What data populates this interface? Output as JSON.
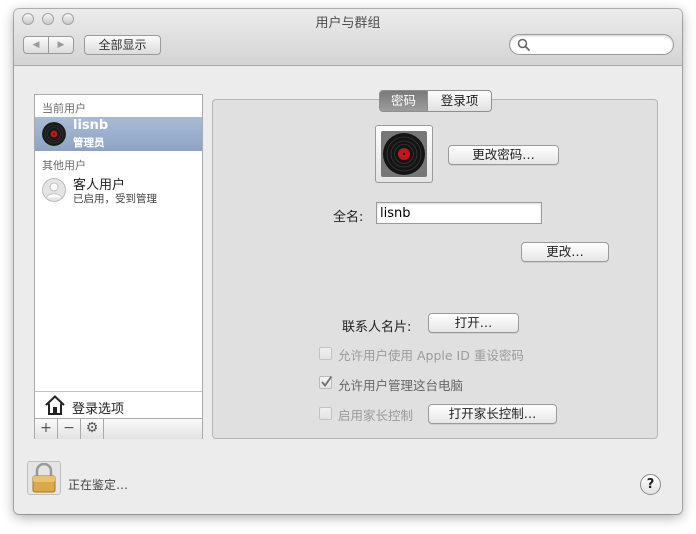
{
  "window": {
    "title": "用户与群组",
    "show_all_label": "全部显示",
    "search_placeholder": ""
  },
  "sidebar": {
    "current_users_header": "当前用户",
    "other_users_header": "其他用户",
    "current_user": {
      "name": "lisnb",
      "role": "管理员"
    },
    "guest_user": {
      "name": "客人用户",
      "status": "已启用，受到管理"
    },
    "login_options_label": "登录选项",
    "toolbar": {
      "add": "+",
      "remove": "−",
      "gear": "⚙"
    }
  },
  "tabs": [
    "密码",
    "登录项"
  ],
  "password_tab": {
    "change_password_button": "更改密码…",
    "full_name_label": "全名:",
    "full_name_value": "lisnb",
    "change_button": "更改…",
    "contact_card_label": "联系人名片:",
    "open_button": "打开…",
    "allow_appleid_reset_label": "允许用户使用 Apple ID 重设密码",
    "allow_admin_label": "允许用户管理这台电脑",
    "parental_controls_label": "启用家长控制",
    "open_parental_controls_button": "打开家长控制…"
  },
  "footer": {
    "status_text": "正在鉴定…",
    "help_label": "?"
  },
  "colors": {
    "selection": "#98aacb",
    "window_bg": "#ececec",
    "pane_bg": "#e0e0e0"
  }
}
